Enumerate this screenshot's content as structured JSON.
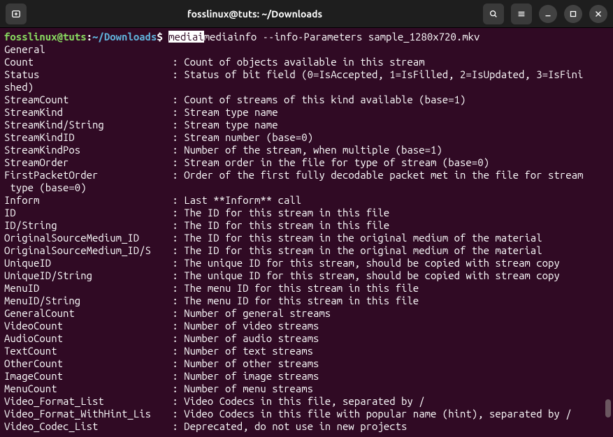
{
  "titlebar": {
    "title": "fosslinux@tuts: ~/Downloads"
  },
  "prompt": {
    "user": "fosslinux@tuts",
    "sep1": ":",
    "path": "~/Downloads",
    "sep2": "$ ",
    "highlighted": "mediai",
    "command": "mediainfo --info-Parameters sample_1280x720.mkv"
  },
  "output": {
    "section": "General",
    "rows": [
      {
        "key": "Count",
        "val": "Count of objects available in this stream"
      },
      {
        "key": "Status",
        "val": "Status of bit field (0=IsAccepted, 1=IsFilled, 2=IsUpdated, 3=IsFini",
        "cont": "shed)"
      },
      {
        "key": "StreamCount",
        "val": "Count of streams of this kind available (base=1)"
      },
      {
        "key": "StreamKind",
        "val": "Stream type name"
      },
      {
        "key": "StreamKind/String",
        "val": "Stream type name"
      },
      {
        "key": "StreamKindID",
        "val": "Stream number (base=0)"
      },
      {
        "key": "StreamKindPos",
        "val": "Number of the stream, when multiple (base=1)"
      },
      {
        "key": "StreamOrder",
        "val": "Stream order in the file for type of stream (base=0)"
      },
      {
        "key": "FirstPacketOrder",
        "val": "Order of the first fully decodable packet met in the file for stream",
        "cont": " type (base=0)"
      },
      {
        "key": "Inform",
        "val": "Last **Inform** call"
      },
      {
        "key": "ID",
        "val": "The ID for this stream in this file"
      },
      {
        "key": "ID/String",
        "val": "The ID for this stream in this file"
      },
      {
        "key": "OriginalSourceMedium_ID",
        "val": "The ID for this stream in the original medium of the material"
      },
      {
        "key": "OriginalSourceMedium_ID/S",
        "val": "The ID for this stream in the original medium of the material"
      },
      {
        "key": "UniqueID",
        "val": "The unique ID for this stream, should be copied with stream copy"
      },
      {
        "key": "UniqueID/String",
        "val": "The unique ID for this stream, should be copied with stream copy"
      },
      {
        "key": "MenuID",
        "val": "The menu ID for this stream in this file"
      },
      {
        "key": "MenuID/String",
        "val": "The menu ID for this stream in this file"
      },
      {
        "key": "GeneralCount",
        "val": "Number of general streams"
      },
      {
        "key": "VideoCount",
        "val": "Number of video streams"
      },
      {
        "key": "AudioCount",
        "val": "Number of audio streams"
      },
      {
        "key": "TextCount",
        "val": "Number of text streams"
      },
      {
        "key": "OtherCount",
        "val": "Number of other streams"
      },
      {
        "key": "ImageCount",
        "val": "Number of image streams"
      },
      {
        "key": "MenuCount",
        "val": "Number of menu streams"
      },
      {
        "key": "Video_Format_List",
        "val": "Video Codecs in this file, separated by /"
      },
      {
        "key": "Video_Format_WithHint_Lis",
        "val": "Video Codecs in this file with popular name (hint), separated by /"
      },
      {
        "key": "Video_Codec_List",
        "val": "Deprecated, do not use in new projects"
      }
    ]
  }
}
